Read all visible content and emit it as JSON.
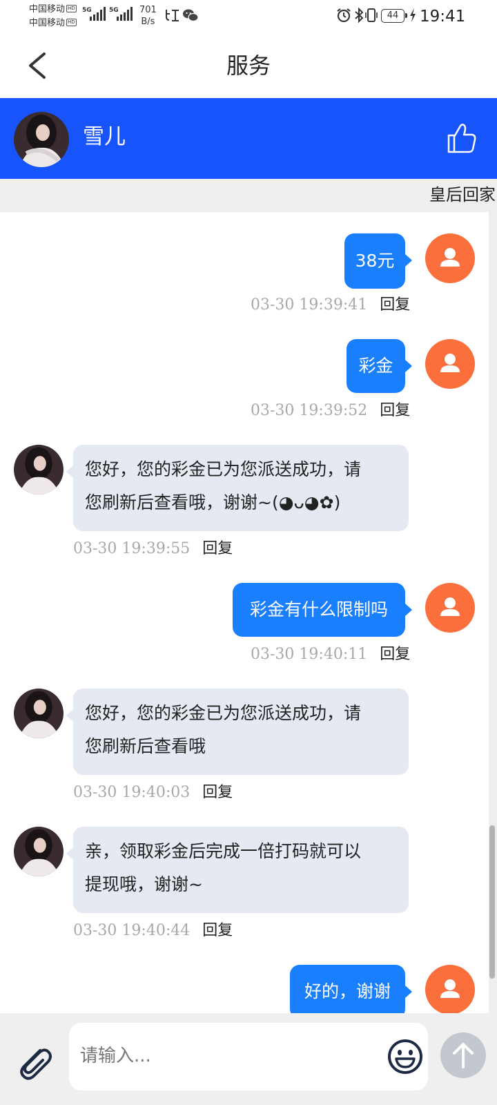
{
  "status_bar": {
    "carrier_1": "中国移动",
    "carrier_2": "中国移动",
    "hd_badge": "HD",
    "network_1": "5G",
    "network_2": "5G",
    "speed_value": "701",
    "speed_unit": "B/s",
    "battery_level": "44",
    "time": "19:41",
    "icons": [
      "signal-icon",
      "listen-app-icon",
      "wechat-icon",
      "alarm-icon",
      "bluetooth-icon",
      "vibrate-icon",
      "charging-icon"
    ]
  },
  "navbar": {
    "title": "服务",
    "back_icon": "chevron-left-icon"
  },
  "agent": {
    "name": "雪儿",
    "like_icon": "thumbs-up-icon",
    "header_color": "#1754fb"
  },
  "marquee": {
    "text": "皇后回家"
  },
  "messages": [
    {
      "sender": "me",
      "text": "38元",
      "time": "03-30 19:39:41",
      "reply": "回复"
    },
    {
      "sender": "me",
      "text": "彩金",
      "time": "03-30 19:39:52",
      "reply": "回复"
    },
    {
      "sender": "agent",
      "line1": "您好，您的彩金已为您派送成功，请",
      "line2": "您刷新后查看哦，谢谢~(◕ᴗ◕✿)",
      "time": "03-30 19:39:55",
      "reply": "回复"
    },
    {
      "sender": "me",
      "text": "彩金有什么限制吗",
      "time": "03-30 19:40:11",
      "reply": "回复"
    },
    {
      "sender": "agent",
      "line1": "您好，您的彩金已为您派送成功，请",
      "line2": "您刷新后查看哦",
      "time": "03-30 19:40:03",
      "reply": "回复"
    },
    {
      "sender": "agent",
      "line1": "亲，领取彩金后完成一倍打码就可以",
      "line2": "提现哦，谢谢~",
      "time": "03-30 19:40:44",
      "reply": "回复"
    },
    {
      "sender": "me",
      "text": "好的，谢谢"
    }
  ],
  "colors": {
    "my_bubble": "#1a7ffc",
    "agent_bubble": "#e5e9f2",
    "my_avatar": "#fb6f3c",
    "timestamp": "#a8a8a8"
  },
  "input": {
    "placeholder": "请输入...",
    "value": "",
    "attach_icon": "paperclip-icon",
    "emoji_icon": "smiley-icon",
    "send_icon": "arrow-up-icon"
  }
}
